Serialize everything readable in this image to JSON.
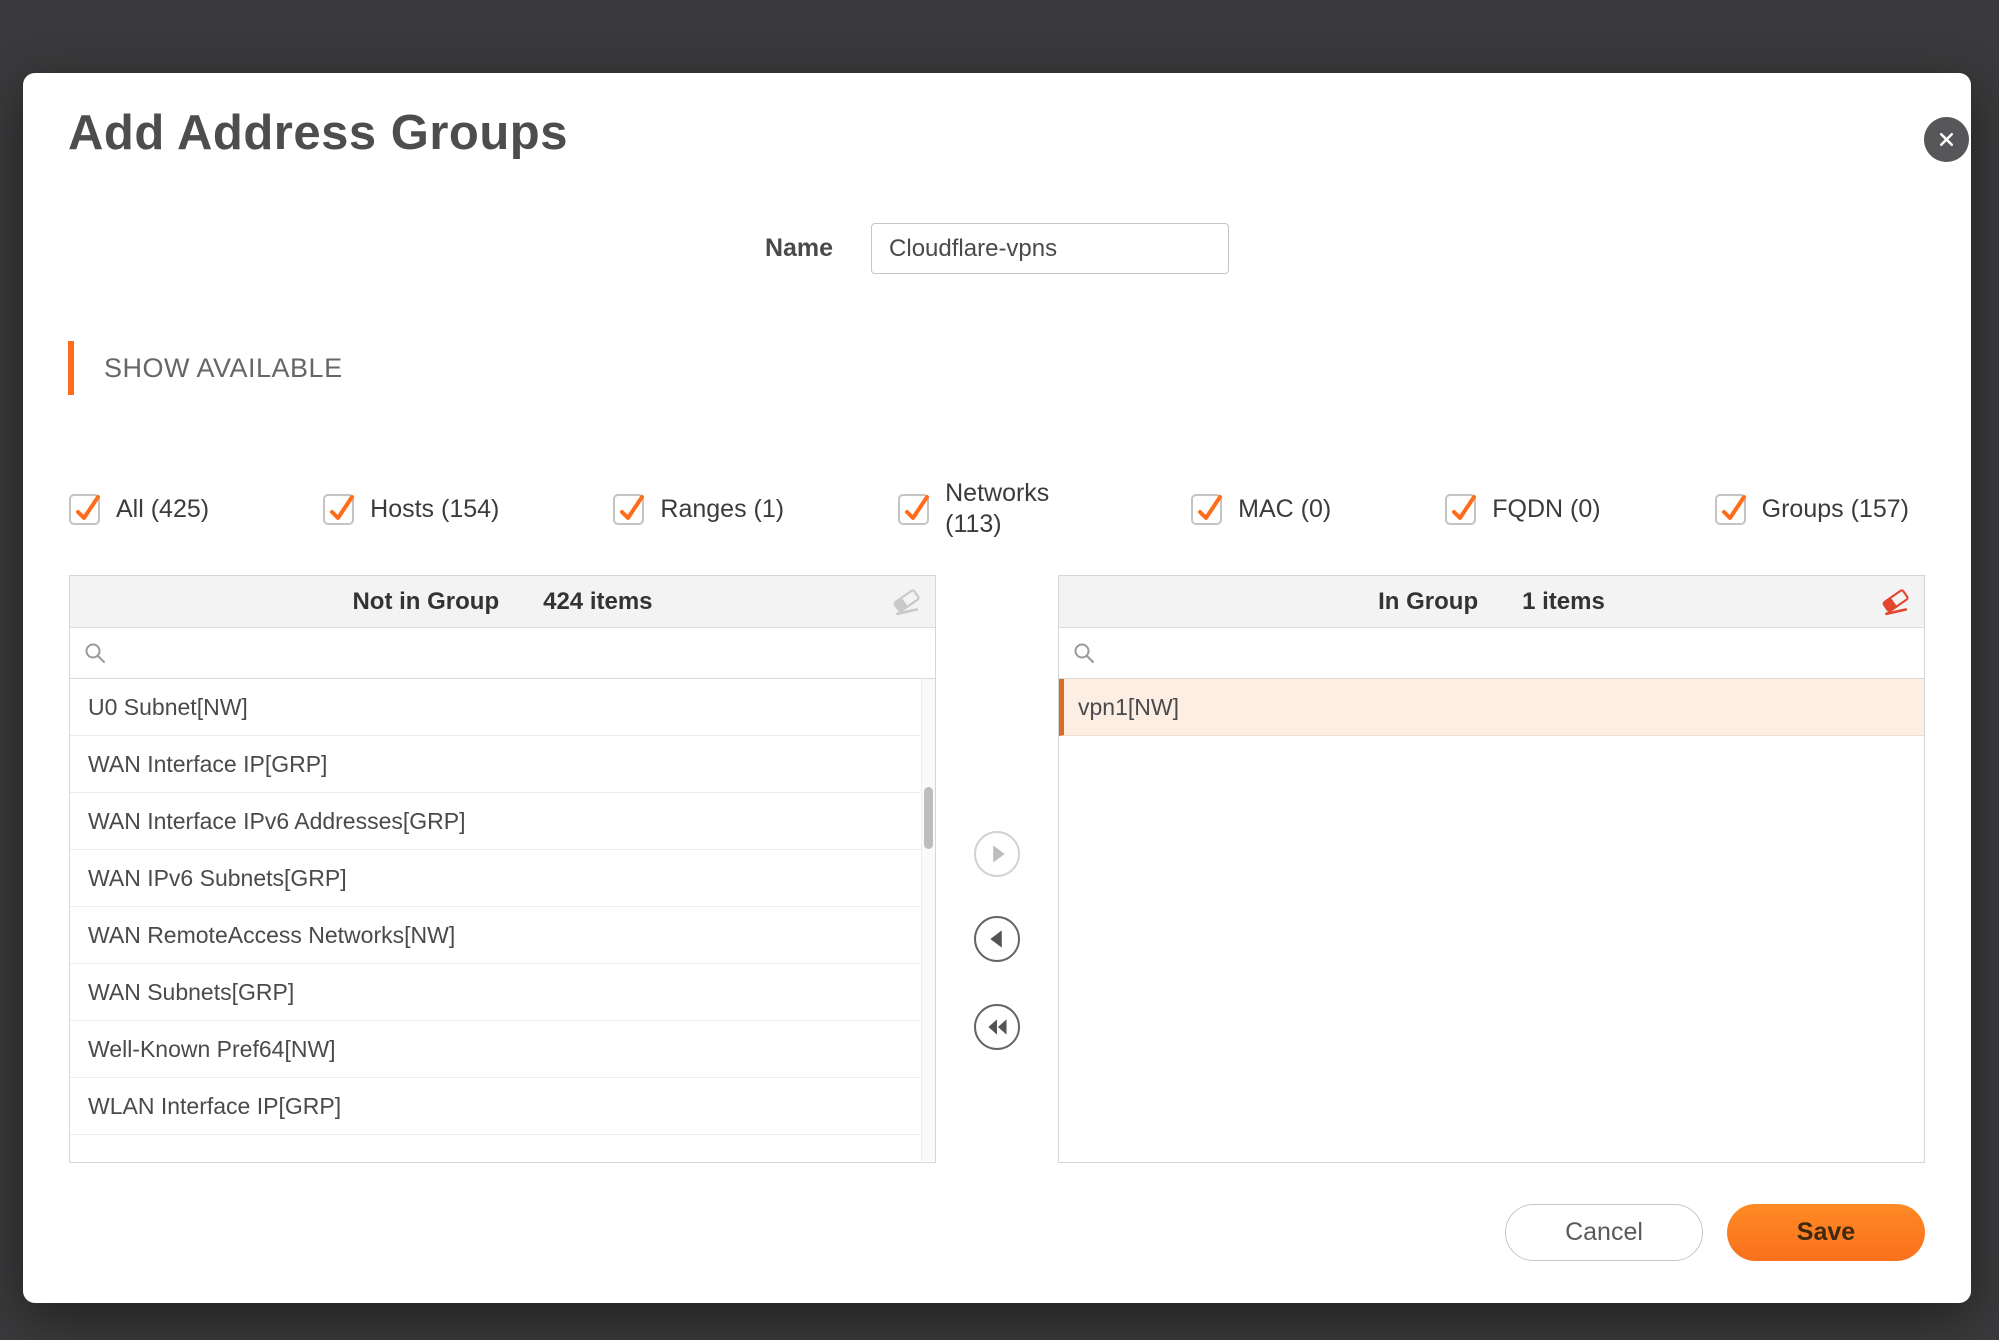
{
  "dialog": {
    "title": "Add Address Groups"
  },
  "name_field": {
    "label": "Name",
    "value": "Cloudflare-vpns",
    "placeholder": ""
  },
  "section": {
    "header": "SHOW AVAILABLE"
  },
  "filters": [
    {
      "label": "All (425)",
      "checked": true
    },
    {
      "label": "Hosts (154)",
      "checked": true
    },
    {
      "label": "Ranges (1)",
      "checked": true
    },
    {
      "label": "Networks (113)",
      "checked": true
    },
    {
      "label": "MAC (0)",
      "checked": true
    },
    {
      "label": "FQDN (0)",
      "checked": true
    },
    {
      "label": "Groups (157)",
      "checked": true
    }
  ],
  "left_panel": {
    "title": "Not in Group",
    "count": "424 items",
    "search_placeholder": "",
    "items": [
      "U0 Subnet[NW]",
      "WAN Interface IP[GRP]",
      "WAN Interface IPv6 Addresses[GRP]",
      "WAN IPv6 Subnets[GRP]",
      "WAN RemoteAccess Networks[NW]",
      "WAN Subnets[GRP]",
      "Well-Known Pref64[NW]",
      "WLAN Interface IP[GRP]"
    ]
  },
  "right_panel": {
    "title": "In Group",
    "count": "1 items",
    "search_placeholder": "",
    "items": [
      "vpn1[NW]"
    ]
  },
  "footer": {
    "cancel_label": "Cancel",
    "save_label": "Save"
  },
  "icons": {
    "close": "x-in-circle",
    "search": "magnifier",
    "eraser_left": "eraser-disabled",
    "eraser_right": "eraser-active",
    "move_right": "arrow-right",
    "move_left": "arrow-left",
    "move_all_left": "double-arrow-left",
    "checkbox_check": "orange-checkmark"
  },
  "colors": {
    "accent_orange": "#ff6c1a",
    "save_button": "#fb751e",
    "selected_item_bg": "#fdeee3",
    "selected_item_border": "#d96b28",
    "eraser_active": "#e2472e",
    "overlay": "#3a3a3c"
  }
}
